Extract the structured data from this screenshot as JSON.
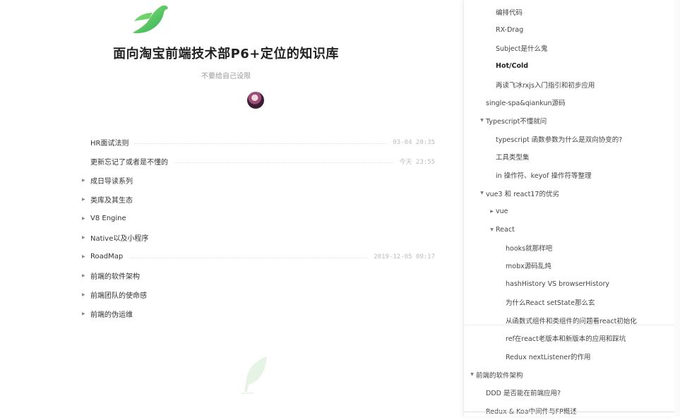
{
  "page": {
    "title": "面向淘宝前端技术部P6+定位的知识库",
    "subtitle": "不要给自己设限"
  },
  "toc": [
    {
      "label": "HR面试法则",
      "date": "03-04 20:35",
      "expandable": false
    },
    {
      "label": "更新忘记了或者是不懂的",
      "date": "今天 23:55",
      "expandable": false
    },
    {
      "label": "成日导读系列",
      "date": "",
      "expandable": true
    },
    {
      "label": "类库及其生态",
      "date": "",
      "expandable": true
    },
    {
      "label": "V8 Engine",
      "date": "",
      "expandable": true
    },
    {
      "label": "Native以及小程序",
      "date": "",
      "expandable": true
    },
    {
      "label": "RoadMap",
      "date": "2019-12-05 09:17",
      "expandable": true
    },
    {
      "label": "前端的软件架构",
      "date": "",
      "expandable": true
    },
    {
      "label": "前端团队的使命感",
      "date": "",
      "expandable": true
    },
    {
      "label": "前端的伪运维",
      "date": "",
      "expandable": true
    }
  ],
  "sidebar": {
    "items": [
      {
        "label": "编排代码",
        "level": 3,
        "toggle": "none"
      },
      {
        "label": "RX-Drag",
        "level": 3,
        "toggle": "none"
      },
      {
        "label": "Subject是什么鬼",
        "level": 3,
        "toggle": "none"
      },
      {
        "label": "Hot/Cold",
        "level": 3,
        "toggle": "none",
        "bold": true
      },
      {
        "label": "再读飞冰rxjs入门指引和初步应用",
        "level": 3,
        "toggle": "none"
      },
      {
        "label": "single-spa&qiankun源码",
        "level": 2,
        "toggle": "none"
      },
      {
        "label": "Typescript不懂就问",
        "level": 2,
        "toggle": "expanded"
      },
      {
        "label": "typescript 函数参数为什么是双向协变的?",
        "level": 3,
        "toggle": "none"
      },
      {
        "label": "工具类型集",
        "level": 3,
        "toggle": "none"
      },
      {
        "label": "in 操作符、keyof 操作符等整理",
        "level": 3,
        "toggle": "none"
      },
      {
        "label": "vue3 和 react17的优劣",
        "level": 2,
        "toggle": "expanded"
      },
      {
        "label": "vue",
        "level": 3,
        "toggle": "collapsed"
      },
      {
        "label": "React",
        "level": 3,
        "toggle": "expanded"
      },
      {
        "label": "hooks就那样吧",
        "level": 4,
        "toggle": "none"
      },
      {
        "label": "mobx源码乱炖",
        "level": 4,
        "toggle": "none"
      },
      {
        "label": "hashHistory VS browserHistory",
        "level": 4,
        "toggle": "none"
      },
      {
        "label": "为什么React setState那么玄",
        "level": 4,
        "toggle": "none"
      },
      {
        "label": "从函数式组件和类组件的问题看react初始化",
        "level": 4,
        "toggle": "none"
      },
      {
        "label": "ref在react老版本和新版本的应用和踩坑",
        "level": 4,
        "toggle": "none"
      },
      {
        "label": "Redux nextListener的作用",
        "level": 4,
        "toggle": "none"
      },
      {
        "label": "前端的软件架构",
        "level": 1,
        "toggle": "expanded"
      },
      {
        "label": "DDD 是否能在前端应用?",
        "level": 2,
        "toggle": "none"
      },
      {
        "label": "Redux & Koa中间件与FP概述",
        "level": 2,
        "toggle": "none"
      }
    ]
  },
  "icons": {
    "logo": "bird-logo-icon",
    "footer": "feather-icon",
    "expanded": "triangle-down-icon",
    "collapsed": "triangle-right-icon"
  },
  "colors": {
    "logo_green": "#4cc460",
    "text": "#333333",
    "muted": "#999999"
  }
}
